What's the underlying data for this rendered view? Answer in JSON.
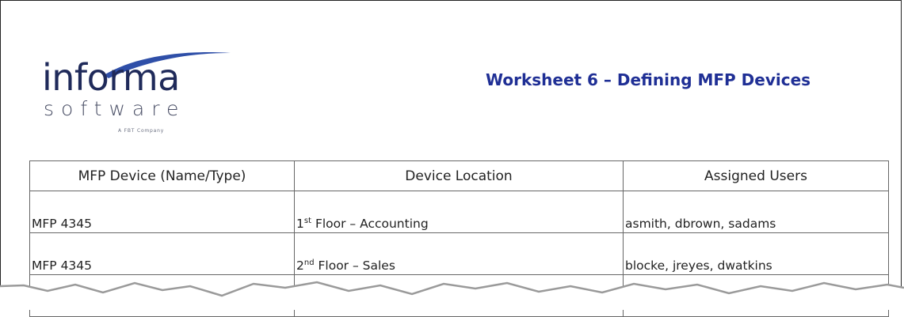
{
  "logo": {
    "word": "informa",
    "sub": "software",
    "tagline": "A FBT Company"
  },
  "title": "Worksheet 6 – Defining MFP Devices",
  "table": {
    "headers": [
      "MFP Device (Name/Type)",
      "Device Location",
      "Assigned Users"
    ],
    "rows": [
      {
        "device": "MFP 4345",
        "loc_num": "1",
        "loc_sup": "st",
        "loc_rest": " Floor – Accounting",
        "users": "asmith, dbrown, sadams"
      },
      {
        "device": "MFP 4345",
        "loc_num": "2",
        "loc_sup": "nd",
        "loc_rest": " Floor – Sales",
        "users": "blocke, jreyes, dwatkins"
      }
    ]
  },
  "colors": {
    "title": "#1f2f95",
    "logo": "#1f2a5a",
    "swoosh": "#2f4fa8"
  }
}
